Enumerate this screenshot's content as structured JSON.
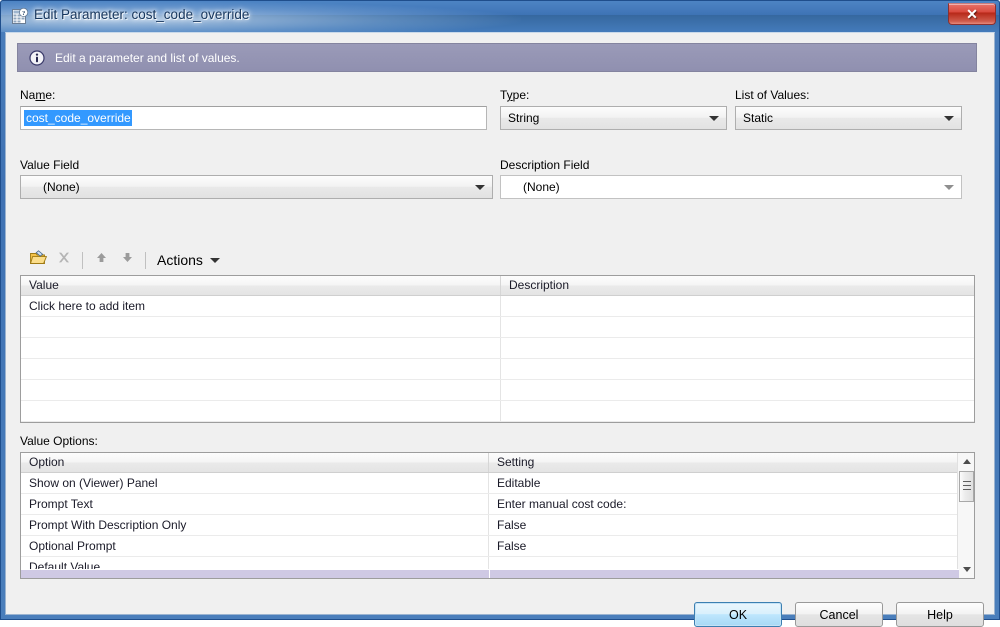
{
  "window": {
    "title": "Edit Parameter: cost_code_override",
    "icon": "parameter-window-icon",
    "close_label": "✕"
  },
  "info_banner": {
    "icon": "info-icon",
    "text": "Edit a parameter and list of values."
  },
  "fields": {
    "name": {
      "label_pre": "Na",
      "label_accel": "m",
      "label_post": "e:",
      "value": "cost_code_override"
    },
    "type": {
      "label_pre": "T",
      "label_accel": "y",
      "label_post": "pe:",
      "value": "String"
    },
    "list_of_values": {
      "label": "List of Values:",
      "value": "Static"
    },
    "value_field": {
      "label": "Value Field",
      "value": "(None)"
    },
    "description_field": {
      "label": "Description Field",
      "value": "(None)"
    }
  },
  "lov_toolbar": {
    "import_icon": "import-folder-icon",
    "delete_icon": "delete-x-icon",
    "move_up_icon": "arrow-up-icon",
    "move_down_icon": "arrow-down-icon",
    "actions_label": "Actions"
  },
  "values_grid": {
    "columns": [
      "Value",
      "Description"
    ],
    "rows": [
      {
        "value": "Click here to add item",
        "description": ""
      },
      {
        "value": "",
        "description": ""
      },
      {
        "value": "",
        "description": ""
      },
      {
        "value": "",
        "description": ""
      },
      {
        "value": "",
        "description": ""
      },
      {
        "value": "",
        "description": ""
      },
      {
        "value": "",
        "description": ""
      }
    ]
  },
  "value_options": {
    "label": "Value Options:",
    "columns": [
      "Option",
      "Setting"
    ],
    "rows": [
      {
        "option": "Show on (Viewer) Panel",
        "setting": "Editable"
      },
      {
        "option": "Prompt Text",
        "setting": "Enter manual cost code:"
      },
      {
        "option": "Prompt With Description Only",
        "setting": "False"
      },
      {
        "option": "Optional Prompt",
        "setting": "False"
      },
      {
        "option": "Default Value",
        "setting": ""
      }
    ]
  },
  "buttons": {
    "ok": "OK",
    "cancel": "Cancel",
    "help": "Help"
  },
  "colors": {
    "titlebar_blue": "#4a7ebb",
    "banner_purple": "#9a9ab8",
    "selection_blue": "#3399ff",
    "default_button_blue": "#bee6fd",
    "hscroll_lavender": "#cfc9e4"
  }
}
